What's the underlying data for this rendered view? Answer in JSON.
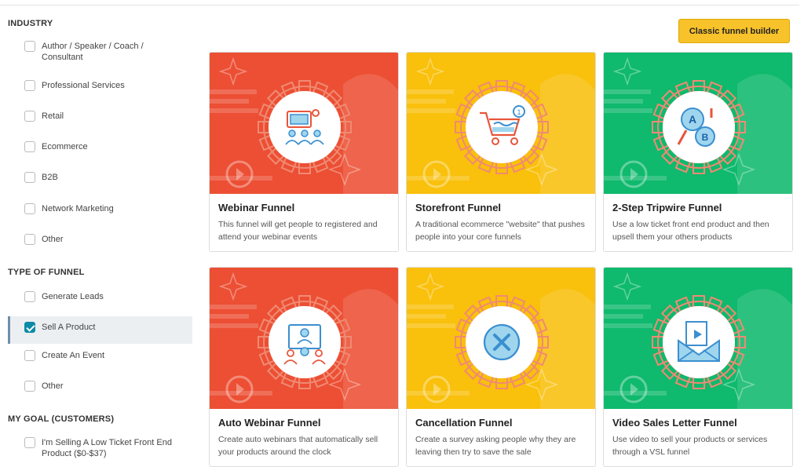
{
  "sidebar": {
    "industry": {
      "title": "INDUSTRY",
      "items": [
        {
          "label": "Author / Speaker / Coach / Consultant",
          "checked": false
        },
        {
          "label": "Professional Services",
          "checked": false
        },
        {
          "label": "Retail",
          "checked": false
        },
        {
          "label": "Ecommerce",
          "checked": false
        },
        {
          "label": "B2B",
          "checked": false
        },
        {
          "label": "Network Marketing",
          "checked": false
        },
        {
          "label": "Other",
          "checked": false
        }
      ]
    },
    "funnel_type": {
      "title": "TYPE OF FUNNEL",
      "items": [
        {
          "label": "Generate Leads",
          "checked": false
        },
        {
          "label": "Sell A Product",
          "checked": true
        },
        {
          "label": "Create An Event",
          "checked": false
        },
        {
          "label": "Other",
          "checked": false
        }
      ]
    },
    "goal": {
      "title": "MY GOAL (CUSTOMERS)",
      "items": [
        {
          "label": "I'm Selling A Low Ticket Front End Product ($0-$37)",
          "checked": false
        }
      ]
    }
  },
  "header": {
    "classic_button": "Classic funnel builder"
  },
  "colors": {
    "red": "#ec4f34",
    "yellow": "#f9c00c",
    "green": "#0fb96d",
    "accent": "#f7c22a",
    "check": "#0b8ba8"
  },
  "cards": [
    {
      "title": "Webinar Funnel",
      "desc": "This funnel will get people to registered and attend your webinar events",
      "color": "red",
      "icon": "webinar-icon"
    },
    {
      "title": "Storefront Funnel",
      "desc": "A traditional ecommerce \"website\" that pushes people into your core funnels",
      "color": "yellow",
      "icon": "cart-icon"
    },
    {
      "title": "2-Step Tripwire Funnel",
      "desc": "Use a low ticket front end product and then upsell them your others products",
      "color": "green",
      "icon": "ab-test-icon"
    },
    {
      "title": "Auto Webinar Funnel",
      "desc": "Create auto webinars that automatically sell your products around the clock",
      "color": "red",
      "icon": "auto-webinar-icon"
    },
    {
      "title": "Cancellation Funnel",
      "desc": "Create a survey asking people why they are leaving then try to save the sale",
      "color": "yellow",
      "icon": "cancel-icon"
    },
    {
      "title": "Video Sales Letter Funnel",
      "desc": "Use video to sell your products or services through a VSL funnel",
      "color": "green",
      "icon": "video-mail-icon"
    }
  ]
}
